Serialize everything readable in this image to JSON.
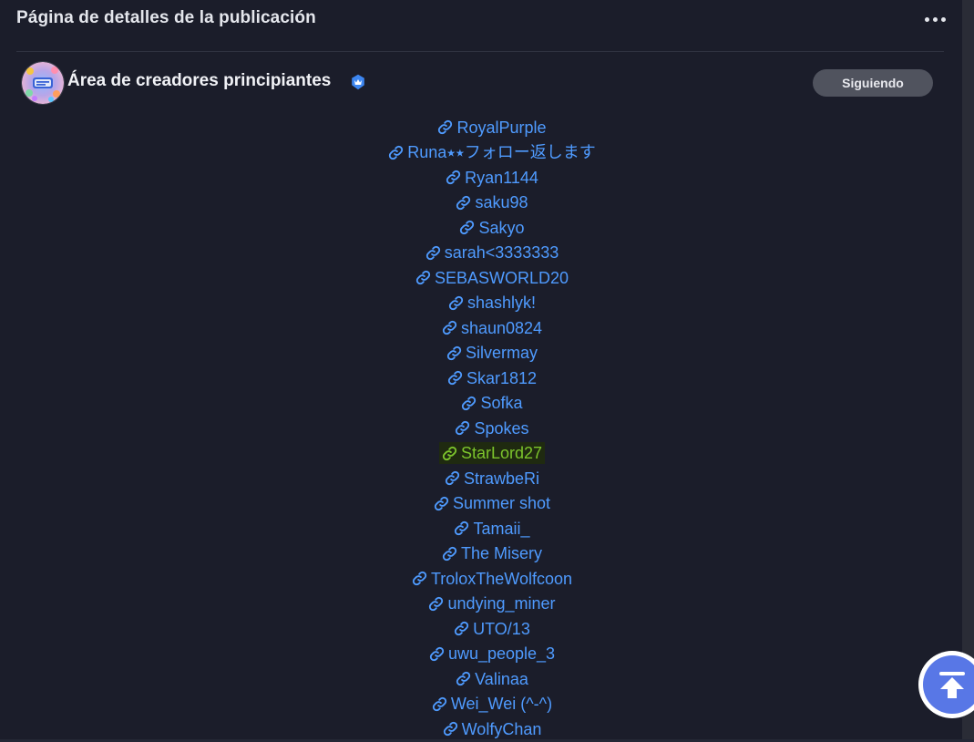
{
  "header": {
    "title": "Página de detalles de la publicación",
    "more_icon": "more-horizontal-icon"
  },
  "community": {
    "name": "Área de creadores principiantes",
    "verified_icon": "verified-badge-icon",
    "follow_label": "Siguiendo"
  },
  "members": [
    {
      "name": "RoyalPurple"
    },
    {
      "name": "Runa⭑⭑フォロー返します"
    },
    {
      "name": "Ryan1144"
    },
    {
      "name": "saku98"
    },
    {
      "name": "Sakyo"
    },
    {
      "name": "sarah<3333333"
    },
    {
      "name": "SEBASWORLD20"
    },
    {
      "name": "shashlyk!"
    },
    {
      "name": "shaun0824"
    },
    {
      "name": "Silvermay"
    },
    {
      "name": "Skar1812"
    },
    {
      "name": "Sofka"
    },
    {
      "name": "Spokes"
    },
    {
      "name": "StarLord27",
      "highlighted": true
    },
    {
      "name": "StrawbeRi"
    },
    {
      "name": "Summer shot"
    },
    {
      "name": "Tamaii_"
    },
    {
      "name": "The Misery"
    },
    {
      "name": "TroloxTheWolfcoon"
    },
    {
      "name": "undying_miner"
    },
    {
      "name": "UTO/13"
    },
    {
      "name": "uwu_people_3"
    },
    {
      "name": "Valinaa"
    },
    {
      "name": "Wei_Wei (^-^)"
    },
    {
      "name": "WolfyChan"
    }
  ],
  "colors": {
    "background": "#1b1d2a",
    "link": "#4f9bff",
    "highlight_text": "#7cc42c",
    "highlight_bg": "#1f2a10",
    "follow_bg": "#50535e",
    "scroll_top": "#5877e6"
  },
  "scroll_top_icon": "arrow-up-to-top-icon"
}
